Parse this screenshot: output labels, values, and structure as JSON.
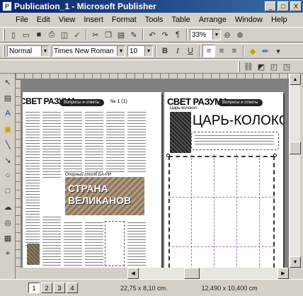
{
  "window": {
    "title": "Publication_1 - Microsoft Publisher",
    "minimize": "_",
    "maximize": "□",
    "close": "X"
  },
  "menu": [
    "File",
    "Edit",
    "View",
    "Insert",
    "Format",
    "Tools",
    "Table",
    "Arrange",
    "Window",
    "Help"
  ],
  "toolbar_standard": {
    "zoom": "33%"
  },
  "toolbar_format": {
    "style": "Normal",
    "font": "Times New Roman",
    "size": "10",
    "bold": "B",
    "italic": "I",
    "underline": "U"
  },
  "document": {
    "left_page": {
      "masthead": "СВЕТ РАЗУМА",
      "pill": "Вопросы и ответы",
      "issue": "№ 1 (1)",
      "promo": [
        "СТРАНА",
        "ВЕЛИКАНОВ"
      ],
      "caption": "Опорный столб  БА-РИ"
    },
    "right_page": {
      "masthead": "СВЕТ РАЗУМА",
      "pill": "Вопросы и ответы",
      "headline": "ЦАРЬ-КОЛОКОЛ",
      "subhead": "Царь-колокол"
    }
  },
  "status": {
    "pages": [
      "1",
      "2",
      "3",
      "4"
    ],
    "active_page": "1",
    "position": "22,75 x 8,10 cm.",
    "size": "12,490 x 10,400 cm"
  },
  "icons": {
    "standard": [
      "new-icon",
      "open-icon",
      "save-icon",
      "print-icon",
      "print-preview-icon",
      "spelling-icon",
      "cut-icon",
      "copy-icon",
      "paste-icon",
      "format-painter-icon",
      "undo-icon",
      "redo-icon",
      "bring-front-icon",
      "send-back-icon",
      "special-characters-icon",
      "zoom-out-icon",
      "zoom-in-icon",
      "help-icon"
    ],
    "objects": [
      "pointer-icon",
      "text-box-icon",
      "table-icon",
      "wordart-icon",
      "picture-icon",
      "line-icon",
      "arrow-icon",
      "oval-icon",
      "rectangle-icon",
      "autoshapes-icon",
      "design-gallery-icon",
      "insert-object-icon",
      "hotspot-icon",
      "form-control-icon",
      "html-fragment-icon"
    ]
  }
}
